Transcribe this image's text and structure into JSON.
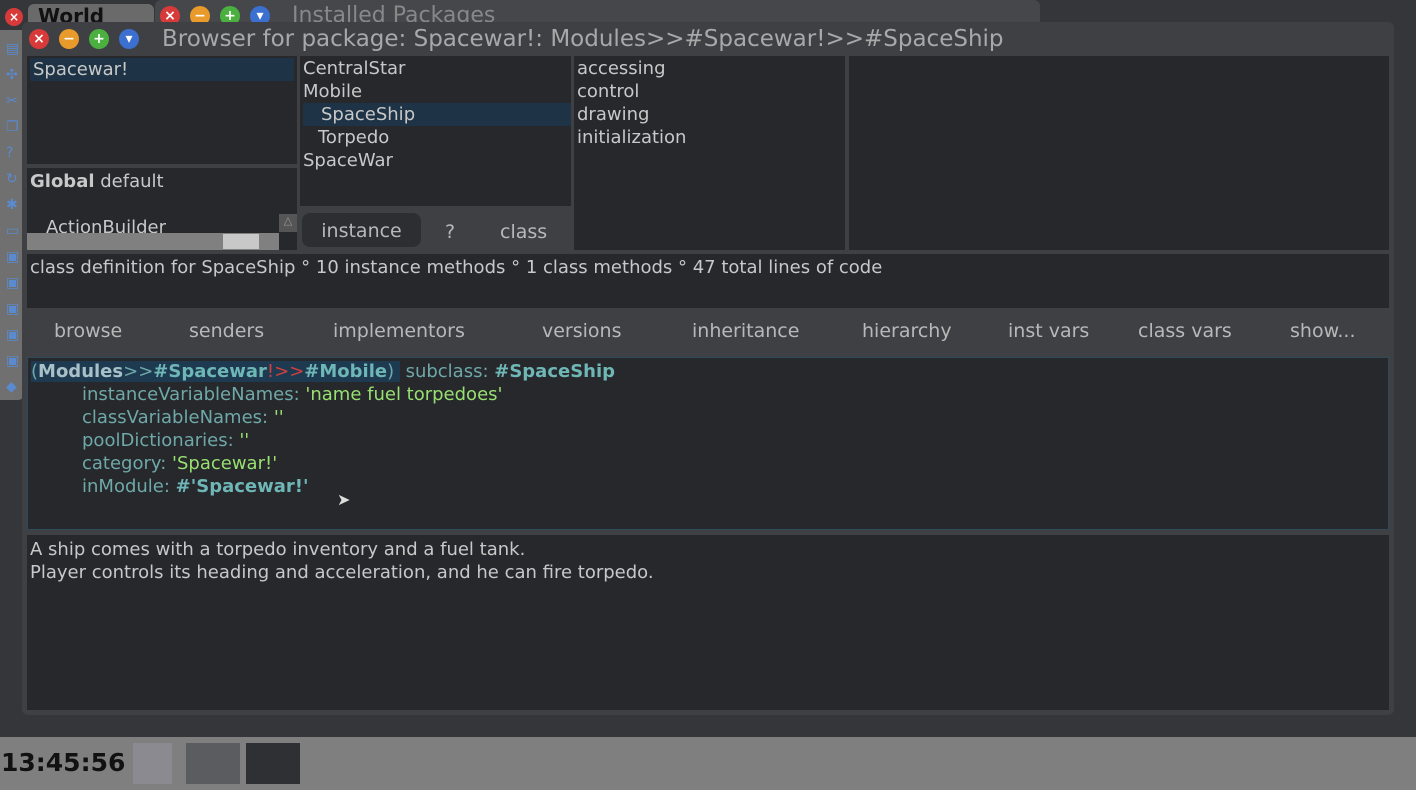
{
  "background_windows": {
    "world_label": "World",
    "installed_title": "Installed Packages"
  },
  "window": {
    "title": "Browser for package: Spacewar!: Modules>>#Spacewar!>>#SpaceShip"
  },
  "packages": [
    {
      "label": "Spacewar!",
      "selected": true
    }
  ],
  "globals": {
    "bold": "Global",
    "rest": " default",
    "item": "ActionBuilder"
  },
  "classes": [
    {
      "label": "CentralStar",
      "indent": 0
    },
    {
      "label": "Mobile",
      "indent": 0
    },
    {
      "label": "SpaceShip",
      "indent": 1,
      "selected": true
    },
    {
      "label": "Torpedo",
      "indent": 1
    },
    {
      "label": "SpaceWar",
      "indent": 0
    }
  ],
  "class_toggle": {
    "instance": "instance",
    "question": "?",
    "class": "class"
  },
  "categories": [
    "accessing",
    "control",
    "drawing",
    "initialization"
  ],
  "status_line": "class definition for SpaceShip ° 10 instance methods ° 1 class methods ° 47 total lines of code",
  "toolbar": [
    "browse",
    "senders",
    "implementors",
    "versions",
    "inheritance",
    "hierarchy",
    "inst vars",
    "class vars",
    "show..."
  ],
  "code": {
    "l1": {
      "paren_open": "(",
      "modules": "Modules",
      "sep1": ">>",
      "spacewar": "#Spacewar",
      "bang": "!>>",
      "mobile": "#Mobile",
      "paren_close": ")",
      "subclass": " subclass: ",
      "name": "#SpaceShip"
    },
    "ivn_key": "instanceVariableNames: ",
    "ivn_val": "'name fuel torpedoes'",
    "cvn_key": "classVariableNames: ",
    "cvn_val": "''",
    "pd_key": "poolDictionaries: ",
    "pd_val": "''",
    "cat_key": "category: ",
    "cat_val": "'Spacewar!'",
    "mod_key": "inModule: ",
    "mod_val": "#'Spacewar!'"
  },
  "comment": [
    "A ship comes with a torpedo inventory and a fuel tank.",
    "Player controls its heading and acceleration, and he can fire torpedo."
  ],
  "taskbar": {
    "clock": "13:45:56"
  }
}
